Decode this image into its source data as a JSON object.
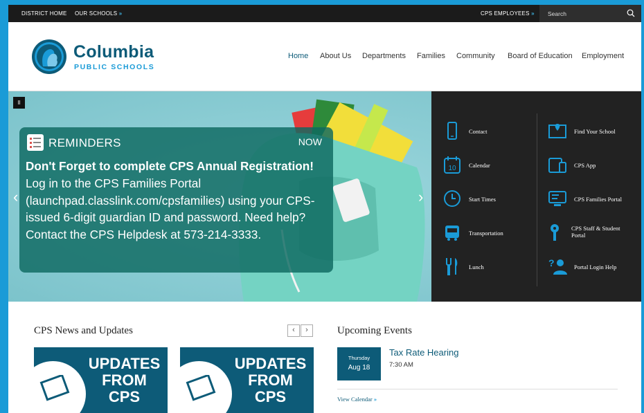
{
  "utility": {
    "district_home": "DISTRICT HOME",
    "our_schools": "OUR SCHOOLS",
    "cps_employees": "CPS EMPLOYEES",
    "chevron": "»",
    "search_placeholder": "Search"
  },
  "logo": {
    "title": "Columbia",
    "subtitle": "PUBLIC SCHOOLS"
  },
  "nav": [
    "Home",
    "About Us",
    "Departments",
    "Families",
    "Community",
    "Board of Education",
    "Employment"
  ],
  "hero": {
    "pause": "II",
    "heading": "REMINDERS",
    "now": "NOW",
    "bold": "Don't Forget to complete CPS Annual Registration!",
    "body": " Log in to the CPS Families Portal (launchpad.classlink.com/cpsfamilies) using your CPS-issued 6-digit guardian ID and password. Need help? Contact the CPS Helpdesk at 573-214-3333.",
    "prev": "‹",
    "next": "›"
  },
  "quicklinks": [
    {
      "label": "Contact",
      "icon": "phone-icon"
    },
    {
      "label": "Find Your School",
      "icon": "map-icon"
    },
    {
      "label": "Calendar",
      "icon": "calendar-icon"
    },
    {
      "label": "CPS App",
      "icon": "devices-icon"
    },
    {
      "label": "Start Times",
      "icon": "clock-icon"
    },
    {
      "label": "CPS Families Portal",
      "icon": "portal-icon"
    },
    {
      "label": "Transportation",
      "icon": "bus-icon"
    },
    {
      "label": "CPS Staff & Student Portal",
      "icon": "key-icon"
    },
    {
      "label": "Lunch",
      "icon": "fork-knife-icon"
    },
    {
      "label": "Portal Login Help",
      "icon": "help-user-icon"
    }
  ],
  "news": {
    "title": "CPS News and Updates",
    "prev": "‹",
    "next": "›",
    "tiles": [
      {
        "text": "UPDATES FROM CPS"
      },
      {
        "text": "UPDATES FROM CPS"
      }
    ]
  },
  "events": {
    "title": "Upcoming Events",
    "items": [
      {
        "day": "Thursday",
        "date": "Aug 18",
        "name": "Tax Rate Hearing",
        "time": "7:30 AM"
      }
    ],
    "view_calendar": "View Calendar",
    "chevron": "»"
  },
  "colors": {
    "brand": "#0d5b78",
    "accent": "#1a9bd7",
    "card": "#0d6960",
    "dark": "#222222"
  }
}
